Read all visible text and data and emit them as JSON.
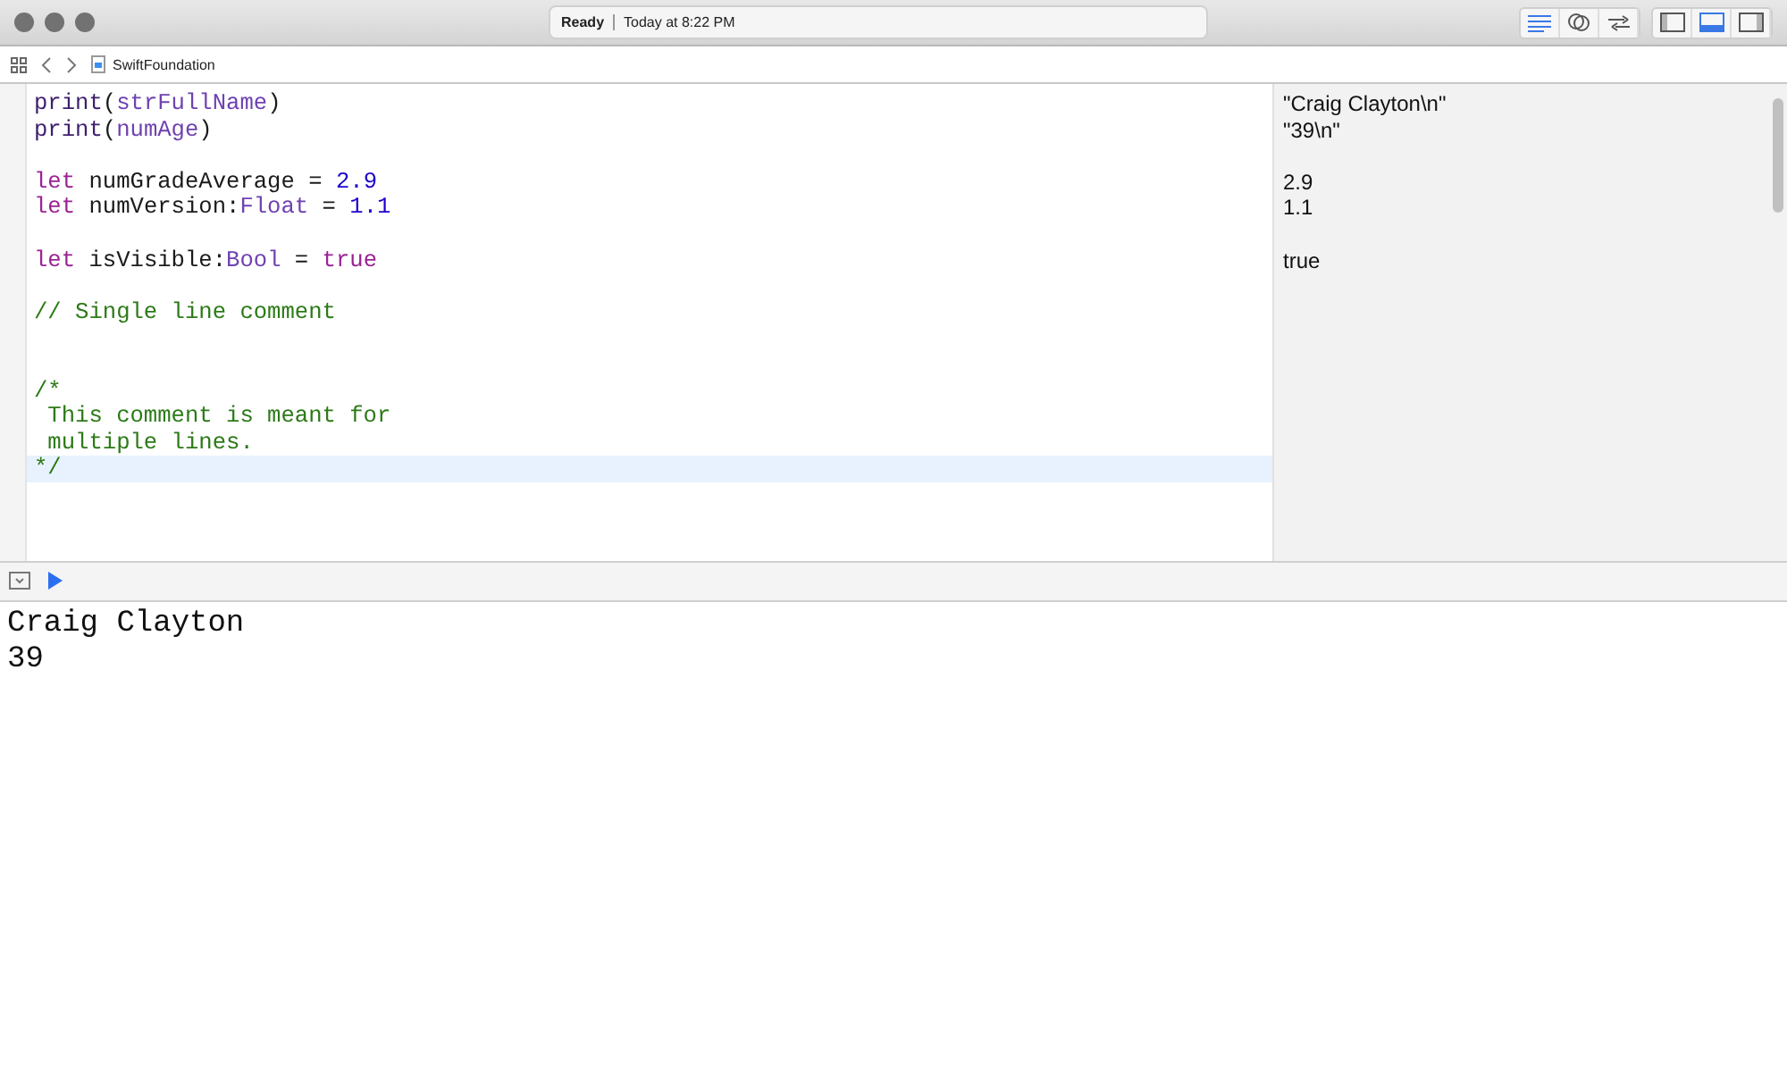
{
  "window": {
    "status": "Ready",
    "timestamp": "Today at 8:22 PM"
  },
  "toolbar": {
    "editor_modes": [
      {
        "kind": "standard",
        "selected": true
      },
      {
        "kind": "assistant",
        "selected": false
      },
      {
        "kind": "version",
        "selected": false
      }
    ],
    "panels": [
      {
        "kind": "left",
        "on": false
      },
      {
        "kind": "bottom",
        "on": true
      },
      {
        "kind": "right",
        "on": false
      }
    ]
  },
  "breadcrumb": {
    "file": "SwiftFoundation"
  },
  "editor": {
    "lines": [
      {
        "current": false,
        "result": "\"Craig Clayton\\n\"",
        "tokens": [
          {
            "kind": "func",
            "text": "print"
          },
          {
            "kind": "plain",
            "text": "("
          },
          {
            "kind": "ident",
            "text": "strFullName"
          },
          {
            "kind": "plain",
            "text": ")"
          }
        ]
      },
      {
        "current": false,
        "result": "\"39\\n\"",
        "tokens": [
          {
            "kind": "func",
            "text": "print"
          },
          {
            "kind": "plain",
            "text": "("
          },
          {
            "kind": "ident",
            "text": "numAge"
          },
          {
            "kind": "plain",
            "text": ")"
          }
        ]
      },
      {
        "current": false
      },
      {
        "current": false,
        "result": "2.9",
        "tokens": [
          {
            "kind": "keyword",
            "text": "let"
          },
          {
            "kind": "plain",
            "text": " numGradeAverage = "
          },
          {
            "kind": "number",
            "text": "2.9"
          }
        ]
      },
      {
        "current": false,
        "result": "1.1",
        "tokens": [
          {
            "kind": "keyword",
            "text": "let"
          },
          {
            "kind": "plain",
            "text": " numVersion:"
          },
          {
            "kind": "ident",
            "text": "Float"
          },
          {
            "kind": "plain",
            "text": " = "
          },
          {
            "kind": "number",
            "text": "1.1"
          }
        ]
      },
      {
        "current": false
      },
      {
        "current": false,
        "result": "true",
        "tokens": [
          {
            "kind": "keyword",
            "text": "let"
          },
          {
            "kind": "plain",
            "text": " isVisible:"
          },
          {
            "kind": "ident",
            "text": "Bool"
          },
          {
            "kind": "plain",
            "text": " = "
          },
          {
            "kind": "keyword",
            "text": "true"
          }
        ]
      },
      {
        "current": false
      },
      {
        "current": false,
        "tokens": [
          {
            "kind": "comment",
            "text": "// Single line comment"
          }
        ]
      },
      {
        "current": false
      },
      {
        "current": false
      },
      {
        "current": false,
        "tokens": [
          {
            "kind": "comment",
            "text": "/*"
          }
        ]
      },
      {
        "current": false,
        "tokens": [
          {
            "kind": "comment",
            "text": " This comment is meant for"
          }
        ]
      },
      {
        "current": false,
        "tokens": [
          {
            "kind": "comment",
            "text": " multiple lines."
          }
        ]
      },
      {
        "current": true,
        "tokens": [
          {
            "kind": "comment",
            "text": "*/"
          }
        ]
      }
    ]
  },
  "console": {
    "lines": [
      "Craig Clayton",
      "39"
    ]
  }
}
